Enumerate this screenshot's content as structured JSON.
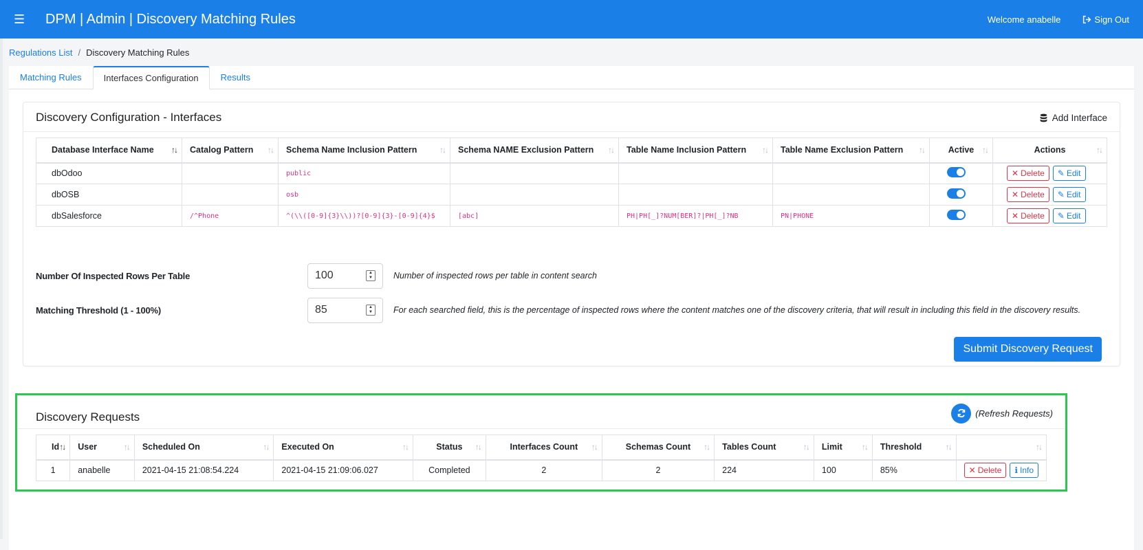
{
  "header": {
    "menu_icon": "hamburger-icon",
    "title": "DPM | Admin | Discovery Matching Rules",
    "welcome": "Welcome anabelle",
    "signout": "Sign Out"
  },
  "breadcrumb": {
    "root": "Regulations List",
    "current": "Discovery Matching Rules"
  },
  "tabs": [
    {
      "label": "Matching Rules",
      "active": false
    },
    {
      "label": "Interfaces Configuration",
      "active": true
    },
    {
      "label": "Results",
      "active": false
    }
  ],
  "interfaces": {
    "title": "Discovery Configuration - Interfaces",
    "add_label": "Add Interface",
    "columns": [
      "Database Interface Name",
      "Catalog Pattern",
      "Schema Name Inclusion Pattern",
      "Schema NAME Exclusion Pattern",
      "Table Name Inclusion Pattern",
      "Table Name Exclusion Pattern",
      "Active",
      "Actions"
    ],
    "rows": [
      {
        "name": "dbOdoo",
        "catalog": "",
        "schema_incl": "public",
        "schema_excl": "",
        "table_incl": "",
        "table_excl": "",
        "active": true
      },
      {
        "name": "dbOSB",
        "catalog": "",
        "schema_incl": "osb",
        "schema_excl": "",
        "table_incl": "",
        "table_excl": "",
        "active": true
      },
      {
        "name": "dbSalesforce",
        "catalog": "/^Phone",
        "schema_incl": "^(\\\\([0-9]{3}\\\\))?[0-9]{3}-[0-9]{4}$",
        "schema_excl": "[abc]",
        "table_incl": "PH|PH[_]?NUM[BER]?|PH[_]?NB",
        "table_excl": "PN|PHONE",
        "active": true
      }
    ],
    "delete_label": "Delete",
    "edit_label": "Edit"
  },
  "settings": {
    "rows_label": "Number Of Inspected Rows Per Table",
    "rows_value": "100",
    "rows_help": "Number of inspected rows per table in content search",
    "threshold_label": "Matching Threshold (1 - 100%)",
    "threshold_value": "85",
    "threshold_help": "For each searched field, this is the percentage of inspected rows where the content matches one of the discovery criteria, that will result in including this field in the discovery results.",
    "submit_label": "Submit Discovery Request"
  },
  "requests": {
    "title": "Discovery Requests",
    "refresh_label": "(Refresh Requests)",
    "columns": [
      "Id",
      "User",
      "Scheduled On",
      "Executed On",
      "Status",
      "Interfaces Count",
      "Schemas Count",
      "Tables Count",
      "Limit",
      "Threshold",
      ""
    ],
    "rows": [
      {
        "id": "1",
        "user": "anabelle",
        "scheduled": "2021-04-15 21:08:54.224",
        "executed": "2021-04-15 21:09:06.027",
        "status": "Completed",
        "interfaces": "2",
        "schemas": "2",
        "tables": "224",
        "limit": "100",
        "threshold": "85%"
      }
    ],
    "delete_label": "Delete",
    "info_label": "Info"
  },
  "colors": {
    "primary": "#1a7fe6",
    "danger": "#dc3545",
    "highlight": "#2dc653",
    "code": "#d63384"
  }
}
